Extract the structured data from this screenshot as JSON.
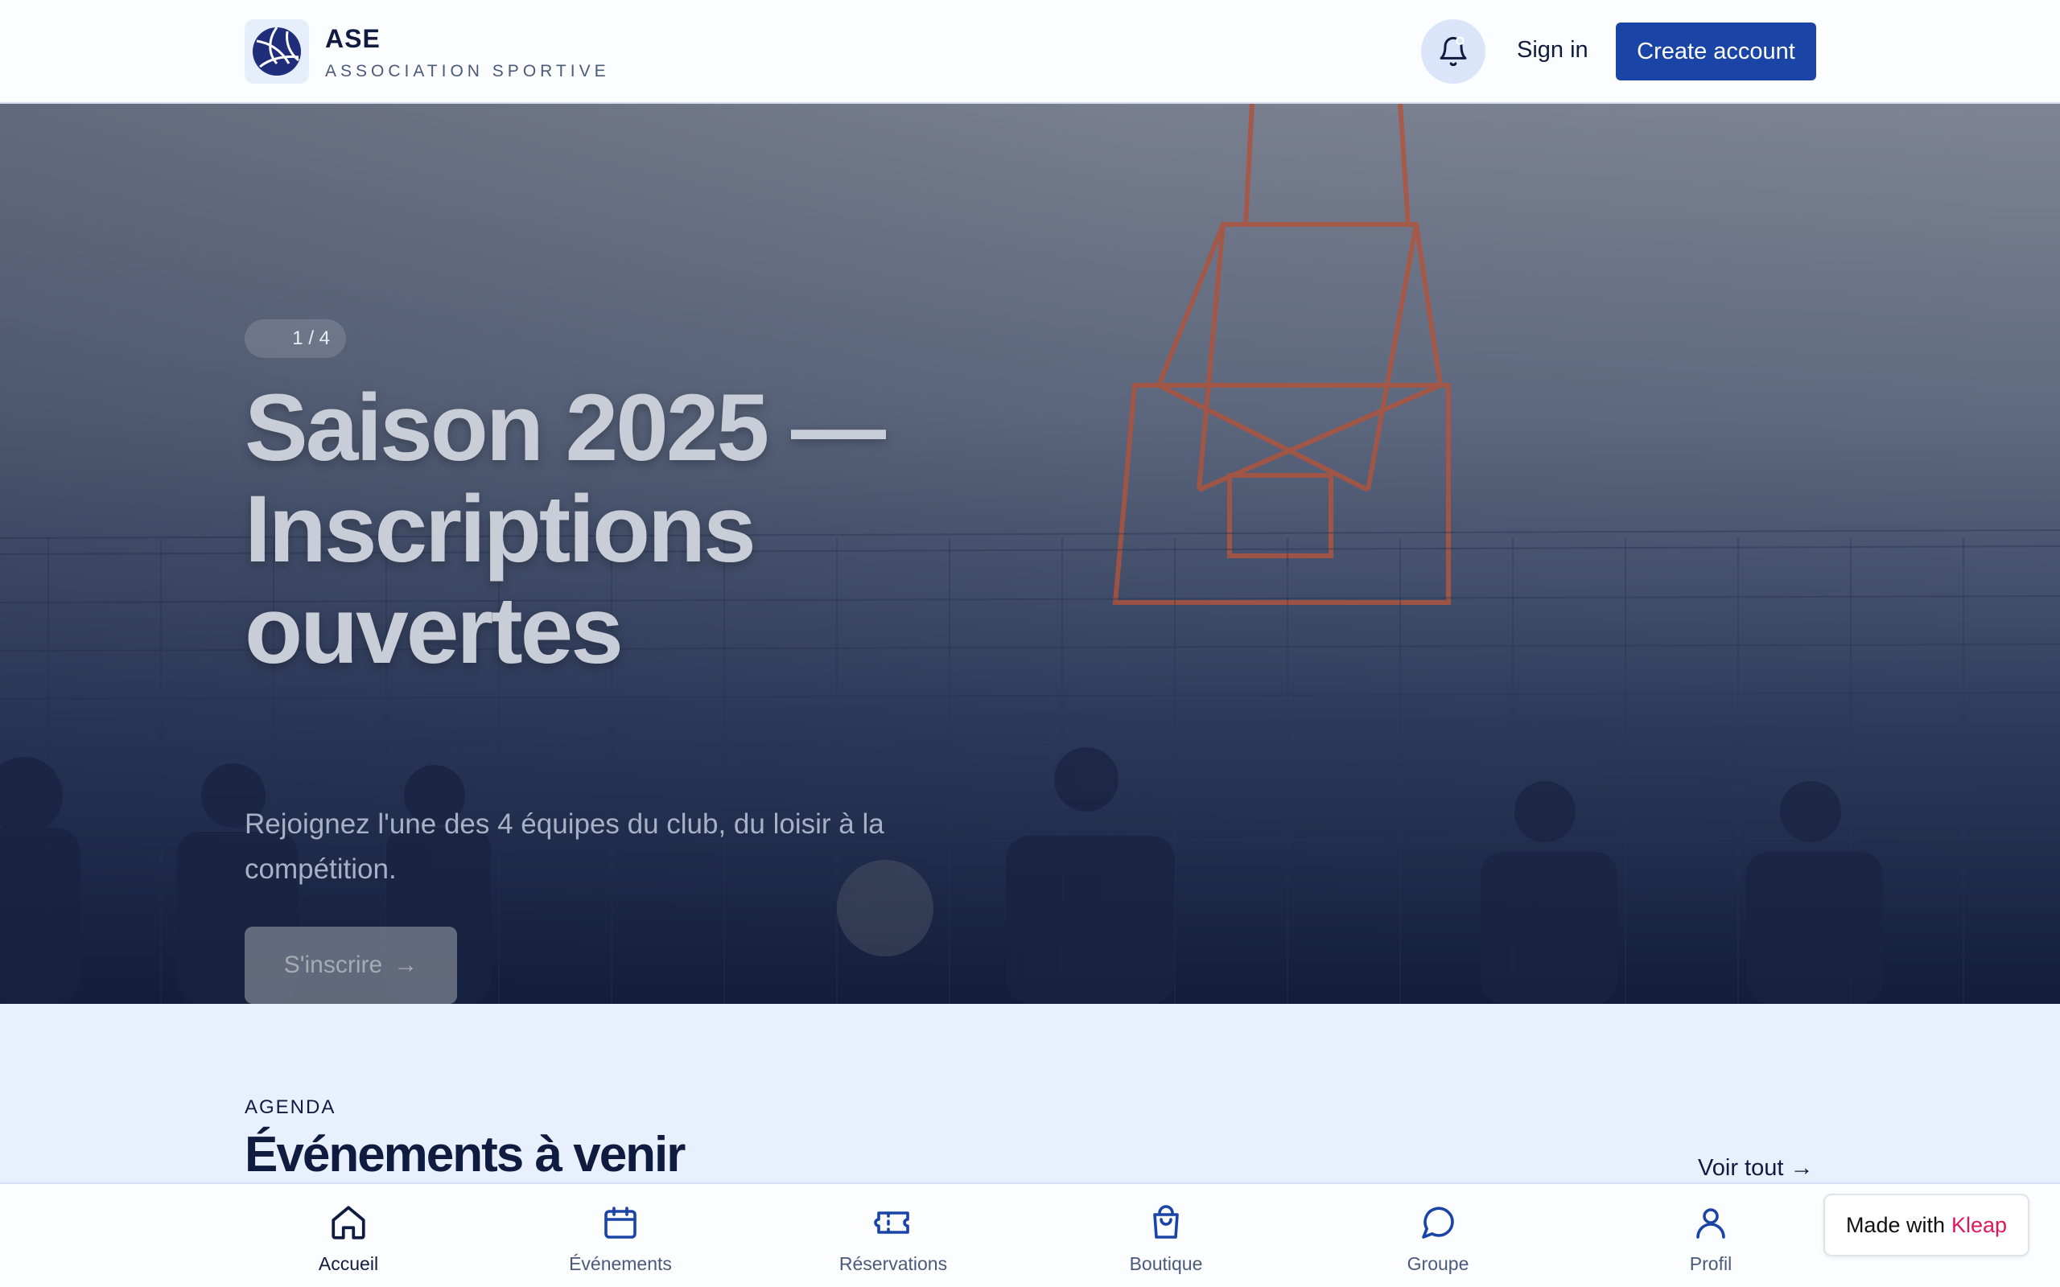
{
  "header": {
    "brand_name": "ASE",
    "brand_subtitle": "ASSOCIATION SPORTIVE",
    "sign_in": "Sign in",
    "create_account": "Create account"
  },
  "hero": {
    "slide_counter": "1 / 4",
    "title": "Saison 2025 — Inscriptions ouvertes",
    "text": "Rejoignez l'une des 4 équipes du club, du loisir à la compétition.",
    "cta": "S'inscrire",
    "cta_arrow": "→",
    "active_slide": 1,
    "total_slides": 4
  },
  "agenda": {
    "kicker": "AGENDA",
    "title": "Événements à venir",
    "see_all": "Voir tout →"
  },
  "bottom_nav": {
    "items": [
      {
        "label": "Accueil",
        "icon": "home-icon",
        "active": true
      },
      {
        "label": "Événements",
        "icon": "calendar-icon",
        "active": false
      },
      {
        "label": "Réservations",
        "icon": "ticket-icon",
        "active": false
      },
      {
        "label": "Boutique",
        "icon": "shopping-bag-icon",
        "active": false
      },
      {
        "label": "Groupe",
        "icon": "chat-bubble-icon",
        "active": false
      },
      {
        "label": "Profil",
        "icon": "user-icon",
        "active": false
      }
    ]
  },
  "badge": {
    "prefix": "Made with",
    "brand": "Kleap"
  },
  "colors": {
    "primary": "#1a44a6",
    "navy": "#0f1c3f",
    "page_bg": "#e9f0fd",
    "kleap_brand": "#e0185a"
  }
}
